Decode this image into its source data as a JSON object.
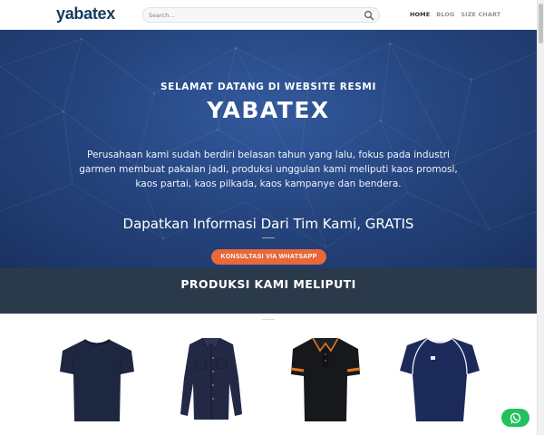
{
  "header": {
    "logo": "yabatex",
    "search_placeholder": "Search...",
    "nav": [
      {
        "label": "HOME",
        "active": true
      },
      {
        "label": "BLOG",
        "active": false
      },
      {
        "label": "SIZE CHART",
        "active": false
      }
    ]
  },
  "hero": {
    "subtitle": "SELAMAT DATANG DI WEBSITE RESMI",
    "title": "YABATEX",
    "description": "Perusahaan kami sudah berdiri belasan tahun yang lalu, fokus pada industri garmen membuat pakaian jadi, produksi unggulan kami meliputi kaos promosi, kaos partai, kaos pilkada, kaos kampanye dan bendera.",
    "info": "Dapatkan Informasi Dari Tim Kami, GRATIS",
    "cta_label": "KONSULTASI VIA WHATSAPP"
  },
  "section": {
    "title": "PRODUKSI KAMI MELIPUTI"
  },
  "products": [
    {
      "icon": "navy-tshirt-icon"
    },
    {
      "icon": "navy-long-sleeve-shirt-icon"
    },
    {
      "icon": "black-polo-shirt-orange-trim-icon"
    },
    {
      "icon": "navy-jersey-icon"
    }
  ],
  "colors": {
    "brand": "#143b5e",
    "hero_bg": "#264680",
    "accent": "#e8683a",
    "band_bg": "#2b3a4b",
    "whatsapp": "#22c15e"
  },
  "floating": {
    "icon": "whatsapp-icon"
  }
}
